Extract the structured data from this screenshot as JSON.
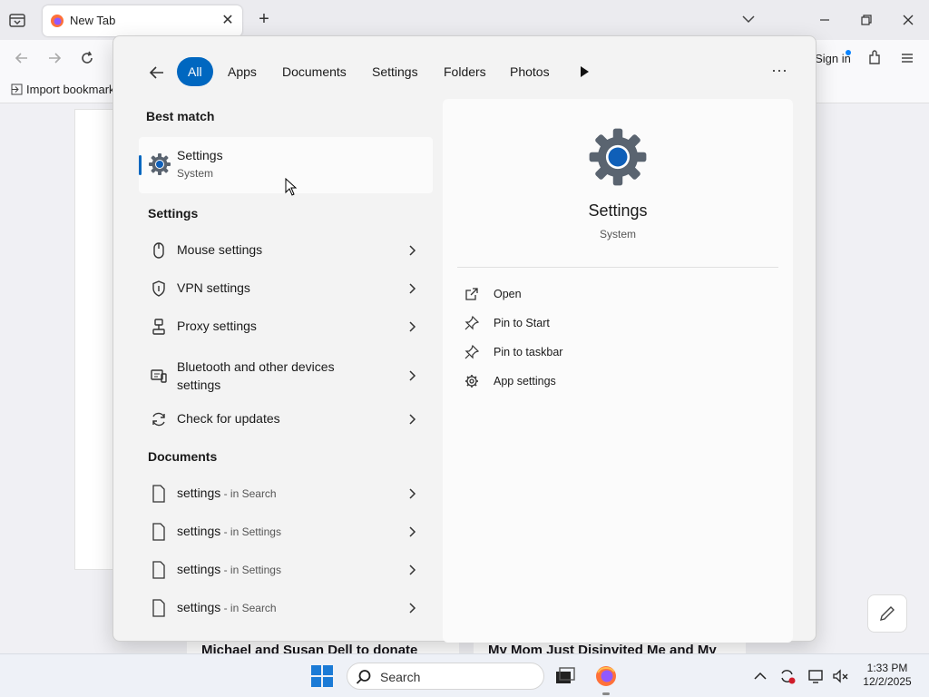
{
  "browser": {
    "tab_title": "New Tab",
    "new_tab_symbol": "+",
    "close_symbol": "✕",
    "sign_in": "Sign in",
    "import_bookmarks": "Import bookmark",
    "news_left": "Michael and Susan Dell to donate",
    "news_right": "My Mom Just Disinvited Me and My"
  },
  "search": {
    "filters": [
      "All",
      "Apps",
      "Documents",
      "Settings",
      "Folders",
      "Photos"
    ],
    "more_symbol": "···",
    "best_match_label": "Best match",
    "best_match": {
      "name": "Settings",
      "sub": "System"
    },
    "settings_label": "Settings",
    "settings_items": [
      {
        "label": "Mouse settings",
        "icon": "mouse-icon"
      },
      {
        "label": "VPN settings",
        "icon": "shield-icon"
      },
      {
        "label": "Proxy settings",
        "icon": "proxy-icon"
      },
      {
        "label": "Bluetooth and other devices settings",
        "icon": "bluetooth-devices-icon"
      },
      {
        "label": "Check for updates",
        "icon": "update-icon"
      }
    ],
    "documents_label": "Documents",
    "documents": [
      {
        "name": "settings",
        "suffix": " - in Search"
      },
      {
        "name": "settings",
        "suffix": " - in Settings"
      },
      {
        "name": "settings",
        "suffix": " - in Settings"
      },
      {
        "name": "settings",
        "suffix": " - in Search"
      }
    ],
    "detail": {
      "title": "Settings",
      "sub": "System",
      "actions": [
        {
          "label": "Open",
          "icon": "open-external-icon"
        },
        {
          "label": "Pin to Start",
          "icon": "pin-icon"
        },
        {
          "label": "Pin to taskbar",
          "icon": "pin-icon"
        },
        {
          "label": "App settings",
          "icon": "gear-icon"
        }
      ]
    }
  },
  "taskbar": {
    "search_label": "Search",
    "time": "1:33 PM",
    "date": "12/2/2025"
  },
  "colors": {
    "accent": "#0067c0",
    "gear_gray": "#5a6470",
    "gear_blue": "#0f5fb8"
  }
}
